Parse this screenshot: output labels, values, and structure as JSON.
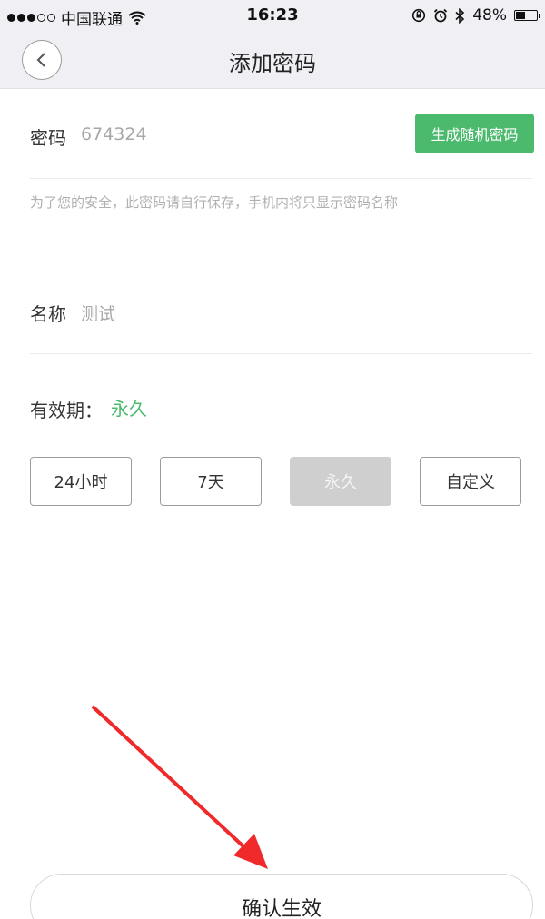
{
  "status_bar": {
    "carrier": "中国联通",
    "time": "16:23",
    "battery": "48%",
    "battery_level": 0.48
  },
  "header": {
    "title": "添加密码"
  },
  "password": {
    "label": "密码",
    "value": "674324",
    "generate_label": "生成随机密码",
    "hint": "为了您的安全，此密码请自行保存，手机内将只显示密码名称"
  },
  "name": {
    "label": "名称",
    "value": "测试"
  },
  "validity": {
    "label": "有效期：",
    "current": "永久",
    "options": [
      {
        "label": "24小时",
        "selected": false
      },
      {
        "label": "7天",
        "selected": false
      },
      {
        "label": "永久",
        "selected": true
      },
      {
        "label": "自定义",
        "selected": false
      }
    ]
  },
  "confirm_label": "确认生效",
  "colors": {
    "accent": "#4cba6d",
    "annotation_arrow": "#f0292b"
  }
}
